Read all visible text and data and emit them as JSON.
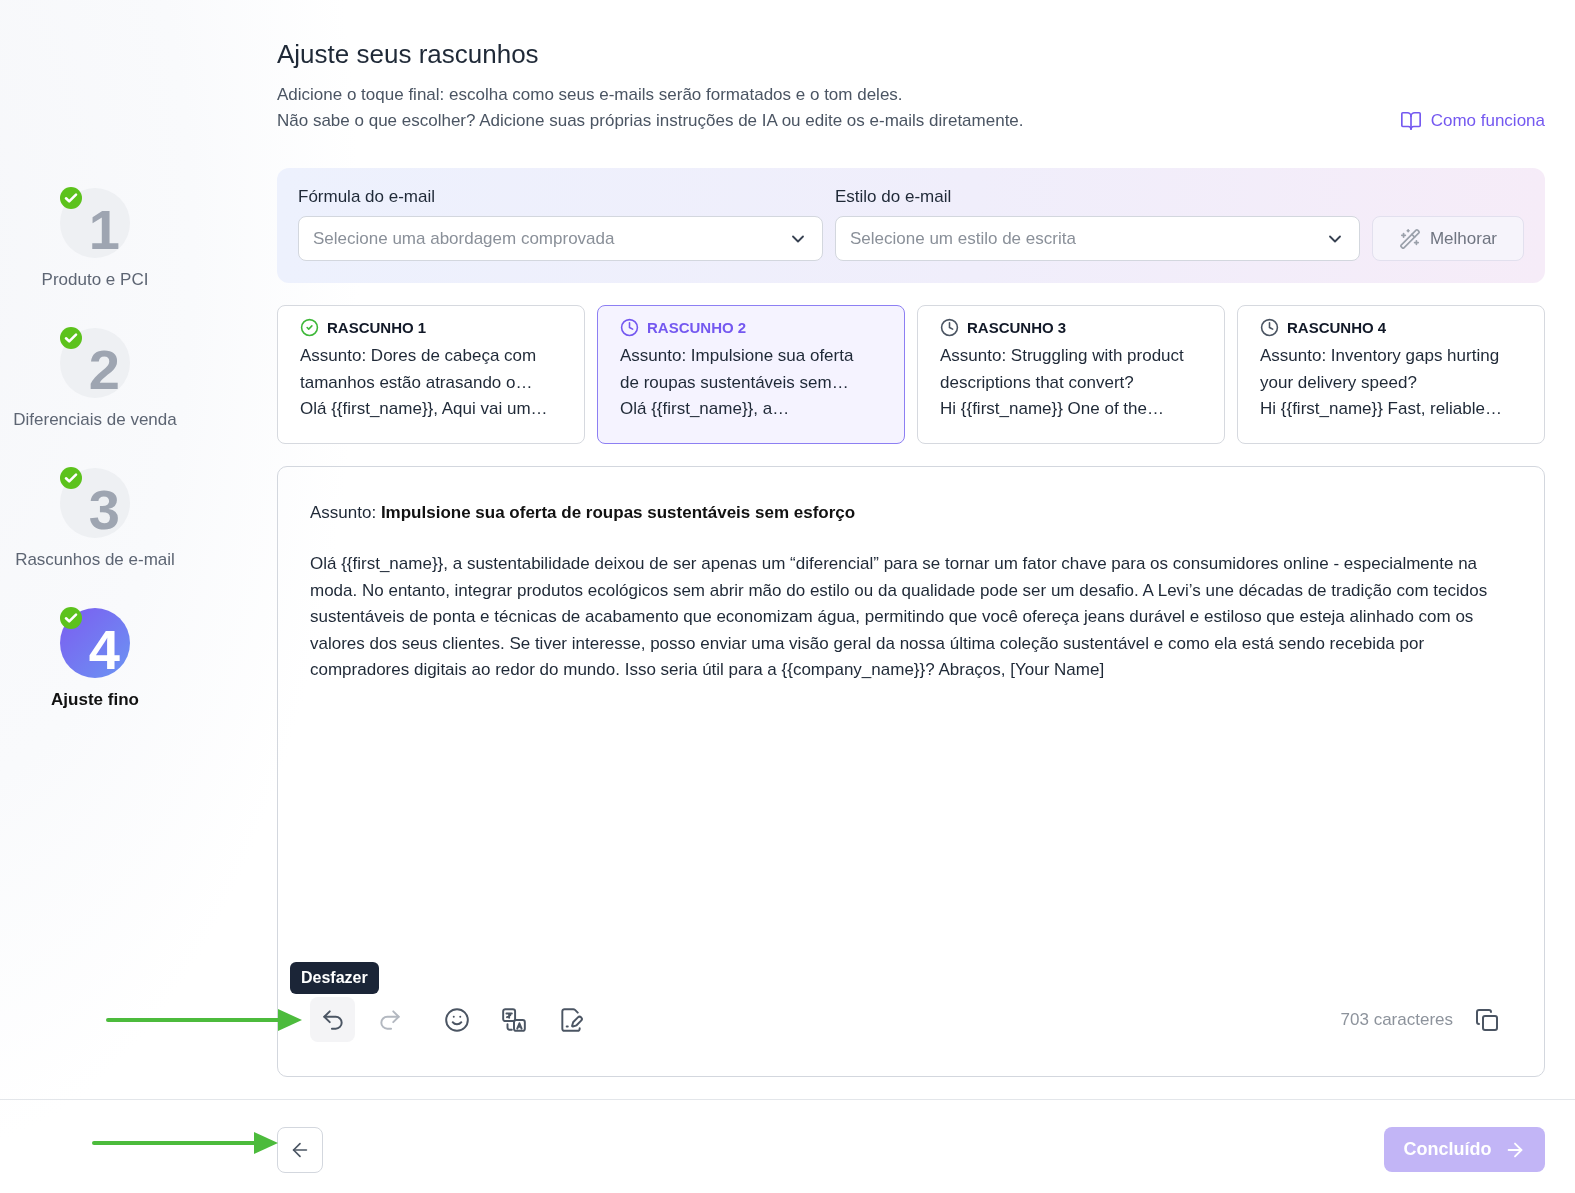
{
  "steps": [
    {
      "number": "1",
      "label": "Produto e PCI",
      "done": true,
      "selected": false
    },
    {
      "number": "2",
      "label": "Diferenciais de venda",
      "done": true,
      "selected": false
    },
    {
      "number": "3",
      "label": "Rascunhos de e-mail",
      "done": true,
      "selected": false
    },
    {
      "number": "4",
      "label": "Ajuste fino",
      "done": true,
      "selected": true
    }
  ],
  "header": {
    "title": "Ajuste seus rascunhos",
    "lines": [
      "Adicione o toque final: escolha como seus e-mails serão formatados e o tom deles.",
      "Não sabe o que escolher? Adicione suas próprias instruções de IA ou edite os e-mails diretamente."
    ],
    "help_link": "Como funciona"
  },
  "settings": {
    "formula": {
      "label": "Fórmula do e-mail",
      "placeholder": "Selecione uma abordagem comprovada"
    },
    "style": {
      "label": "Estilo do e-mail",
      "placeholder": "Selecione um estilo de escrita"
    },
    "improve_button": {
      "label": "Melhorar",
      "disabled": true
    }
  },
  "drafts": [
    {
      "title": "RASCUNHO 1",
      "completed": true,
      "selected": false,
      "subject": "Assunto: Dores de cabeça com tamanhos estão atrasando o…",
      "preview": "Olá {{first_name}}, Aqui vai um…"
    },
    {
      "title": "RASCUNHO 2",
      "completed": false,
      "selected": true,
      "subject": "Assunto: Impulsione sua oferta de roupas sustentáveis sem…",
      "preview": "Olá {{first_name}}, a…"
    },
    {
      "title": "RASCUNHO 3",
      "completed": false,
      "selected": false,
      "subject": "Assunto: Struggling with product descriptions that convert?",
      "preview": "Hi {{first_name}} One of the…"
    },
    {
      "title": "RASCUNHO 4",
      "completed": false,
      "selected": false,
      "subject": "Assunto: Inventory gaps hurting your delivery speed?",
      "preview": "Hi {{first_name}} Fast, reliable…"
    }
  ],
  "editor": {
    "subject": "Assunto: **Impulsione sua oferta de roupas sustentáveis sem esforço**",
    "body": "Olá {{first_name}}, a sustentabilidade deixou de ser apenas um “diferencial” para se tornar um fator chave para os consumidores online - especialmente na moda. No entanto, integrar produtos ecológicos sem abrir mão do estilo ou da qualidade pode ser um desafio. A Levi’s une décadas de tradição com tecidos sustentáveis de ponta e técnicas de acabamento que economizam água, permitindo que você ofereça jeans durável e estiloso que esteja alinhado com os valores dos seus clientes. Se tiver interesse, posso enviar uma visão geral da nossa última coleção sustentável e como ela está sendo recebida por compradores digitais ao redor do mundo. Isso seria útil para a {{company_name}}? Abraços, [Your Name]",
    "toolbar": [
      {
        "kind": "undo",
        "disabled": false,
        "tooltip": "Desfazer"
      },
      {
        "kind": "redo",
        "disabled": true
      },
      {
        "kind": "emoji",
        "disabled": false
      },
      {
        "kind": "translate",
        "disabled": false
      },
      {
        "kind": "notes",
        "disabled": false
      }
    ],
    "char_count": "703 caracteres"
  },
  "footer": {
    "done_button": {
      "label": "Concluído",
      "disabled": true
    }
  }
}
